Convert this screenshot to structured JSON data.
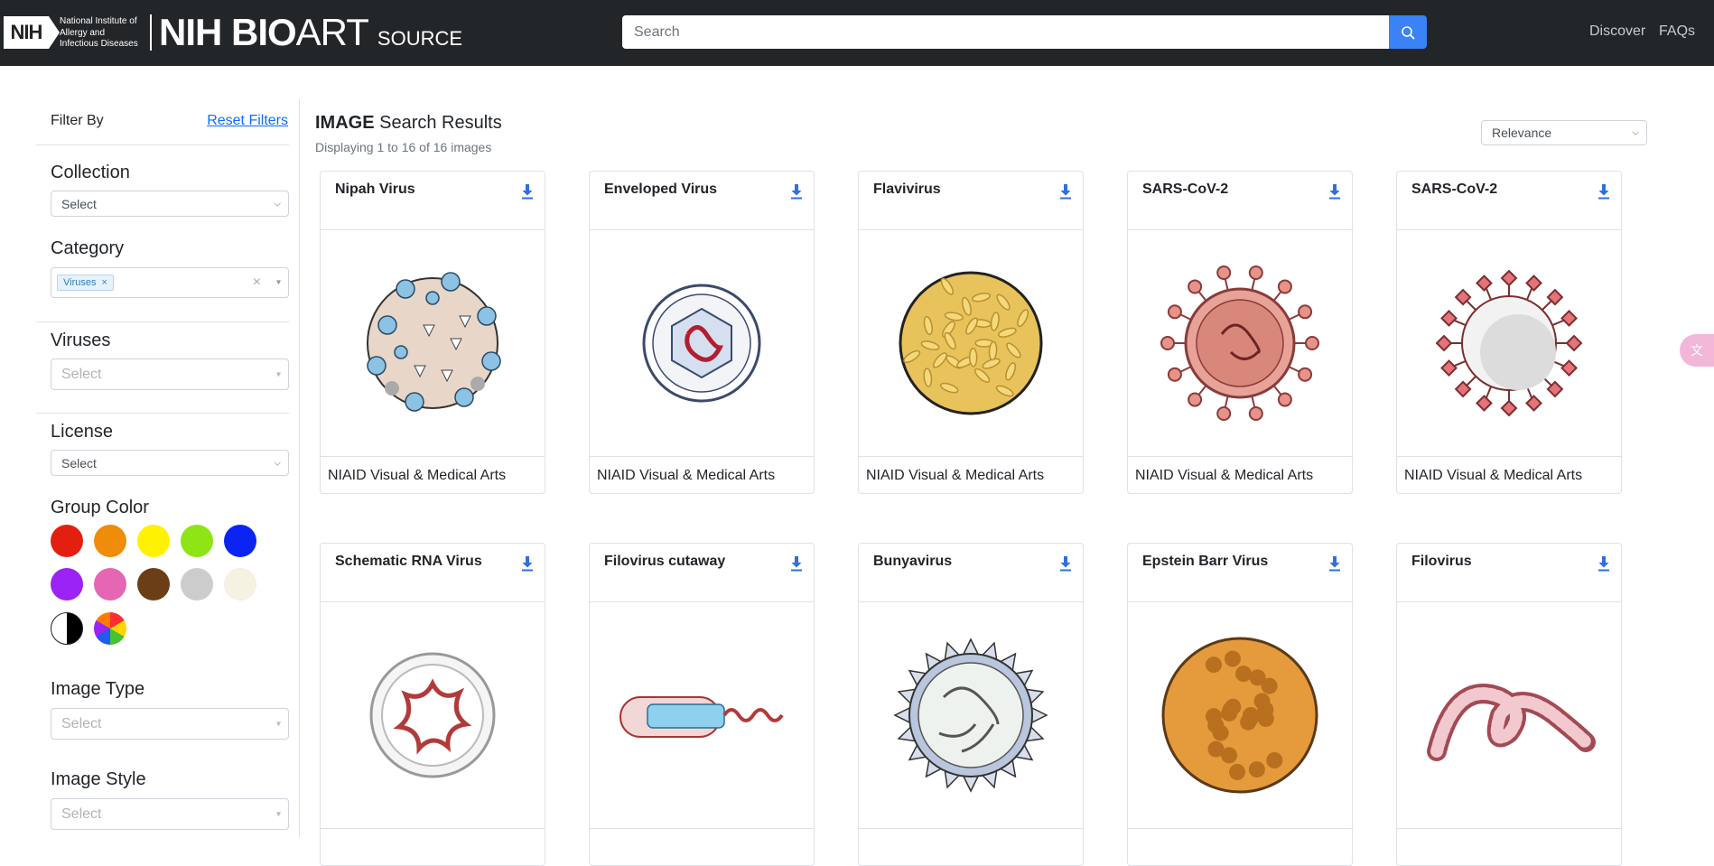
{
  "header": {
    "nih_box": "NIH",
    "institute_lines": [
      "National Institute of",
      "Allergy and",
      "Infectious Diseases"
    ],
    "brand_bold": "NIH BIO",
    "brand_thin": "ART",
    "brand_source": "SOURCE",
    "search_placeholder": "Search",
    "nav": [
      "Discover",
      "FAQs"
    ]
  },
  "sidebar": {
    "filter_by": "Filter By",
    "reset": "Reset Filters",
    "collection": {
      "label": "Collection",
      "value": "Select"
    },
    "category": {
      "label": "Category",
      "chip": "Viruses",
      "chip_remove": "×",
      "clear": "×"
    },
    "viruses": {
      "label": "Viruses",
      "placeholder": "Select"
    },
    "license": {
      "label": "License",
      "value": "Select"
    },
    "group_color": {
      "label": "Group Color",
      "colors": [
        "#e3200f",
        "#ef8c0a",
        "#fff200",
        "#8ee414",
        "#0b24f4",
        "#9b23f5",
        "#e566b2",
        "#6b3e16",
        "#cccccc",
        "#f5f2e1"
      ]
    },
    "image_type": {
      "label": "Image Type",
      "placeholder": "Select"
    },
    "image_style": {
      "label": "Image Style",
      "placeholder": "Select"
    }
  },
  "results": {
    "title_bold": "IMAGE",
    "title_rest": " Search Results",
    "subtitle": "Displaying 1 to 16 of 16 images",
    "sort": "Relevance",
    "cards": [
      {
        "title": "Nipah Virus",
        "credit": "NIAID Visual & Medical Arts",
        "icon": "nipah-virus-icon"
      },
      {
        "title": "Enveloped Virus",
        "credit": "NIAID Visual & Medical Arts",
        "icon": "enveloped-virus-icon"
      },
      {
        "title": "Flavivirus",
        "credit": "NIAID Visual & Medical Arts",
        "icon": "flavivirus-icon"
      },
      {
        "title": "SARS-CoV-2",
        "credit": "NIAID Visual & Medical Arts",
        "icon": "sars-cov-2-cutaway-icon"
      },
      {
        "title": "SARS-CoV-2",
        "credit": "NIAID Visual & Medical Arts",
        "icon": "sars-cov-2-icon"
      },
      {
        "title": "Schematic RNA Virus",
        "credit": "",
        "icon": "rna-virus-icon"
      },
      {
        "title": "Filovirus cutaway",
        "credit": "",
        "icon": "filovirus-cutaway-icon"
      },
      {
        "title": "Bunyavirus",
        "credit": "",
        "icon": "bunyavirus-icon"
      },
      {
        "title": "Epstein Barr Virus",
        "credit": "",
        "icon": "epstein-barr-virus-icon"
      },
      {
        "title": "Filovirus",
        "credit": "",
        "icon": "filovirus-icon"
      }
    ]
  }
}
